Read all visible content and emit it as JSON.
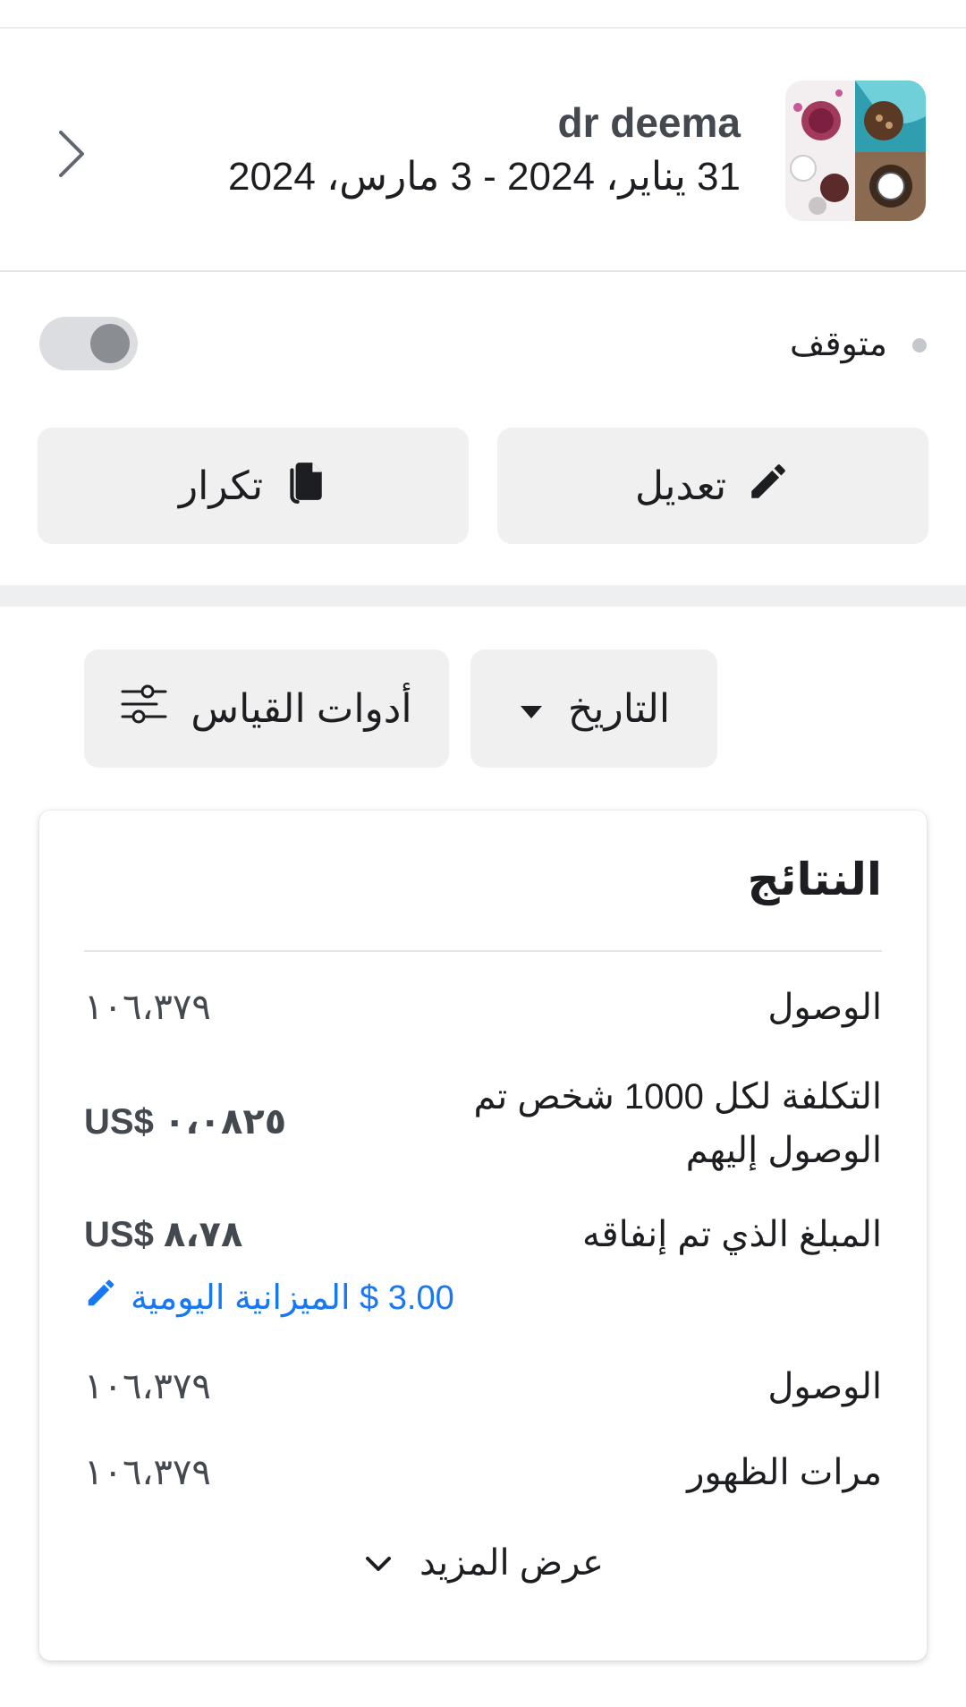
{
  "campaign": {
    "title": "dr deema",
    "dates": "31 يناير، 2024 - 3 مارس، 2024"
  },
  "status": {
    "label": "متوقف",
    "toggle_on": false
  },
  "actions": {
    "edit_label": "تعديل",
    "duplicate_label": "تكرار"
  },
  "filters": {
    "date_label": "التاريخ",
    "metrics_label": "أدوات القياس"
  },
  "results": {
    "title": "النتائج",
    "rows": [
      {
        "label": "الوصول",
        "value": "١٠٦،٣٧٩"
      },
      {
        "label": "التكلفة لكل 1000 شخص تم الوصول إليهم",
        "value": "US$ ٠،٠٨٢٥"
      },
      {
        "label": "المبلغ الذي تم إنفاقه",
        "value": "US$ ٨،٧٨"
      },
      {
        "label": "الوصول",
        "value": "١٠٦،٣٧٩"
      },
      {
        "label": "مرات الظهور",
        "value": "١٠٦،٣٧٩"
      }
    ],
    "daily_budget": "3.00 $ الميزانية اليومية",
    "show_more": "عرض المزيد"
  },
  "colors": {
    "link": "#1877f2",
    "button_bg": "#f0f0f0",
    "text": "#1c1e21"
  }
}
